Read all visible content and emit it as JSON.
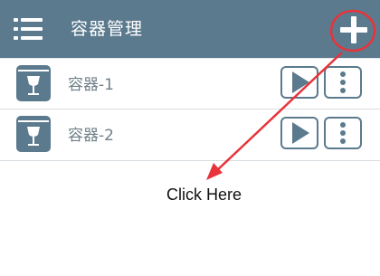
{
  "header": {
    "title": "容器管理",
    "menu_icon": "hamburger-menu-icon",
    "add_icon": "plus-icon"
  },
  "containers": [
    {
      "label": "容器-1",
      "icon": "wine-box-icon"
    },
    {
      "label": "容器-2",
      "icon": "wine-box-icon"
    }
  ],
  "row_actions": {
    "play_icon": "play-icon",
    "more_icon": "vertical-dots-icon"
  },
  "annotation": {
    "text": "Click Here",
    "color": "#e8333a"
  },
  "colors": {
    "header_bg": "#5b7a8e",
    "accent": "#5b7a8e",
    "label": "#6f7f89"
  }
}
